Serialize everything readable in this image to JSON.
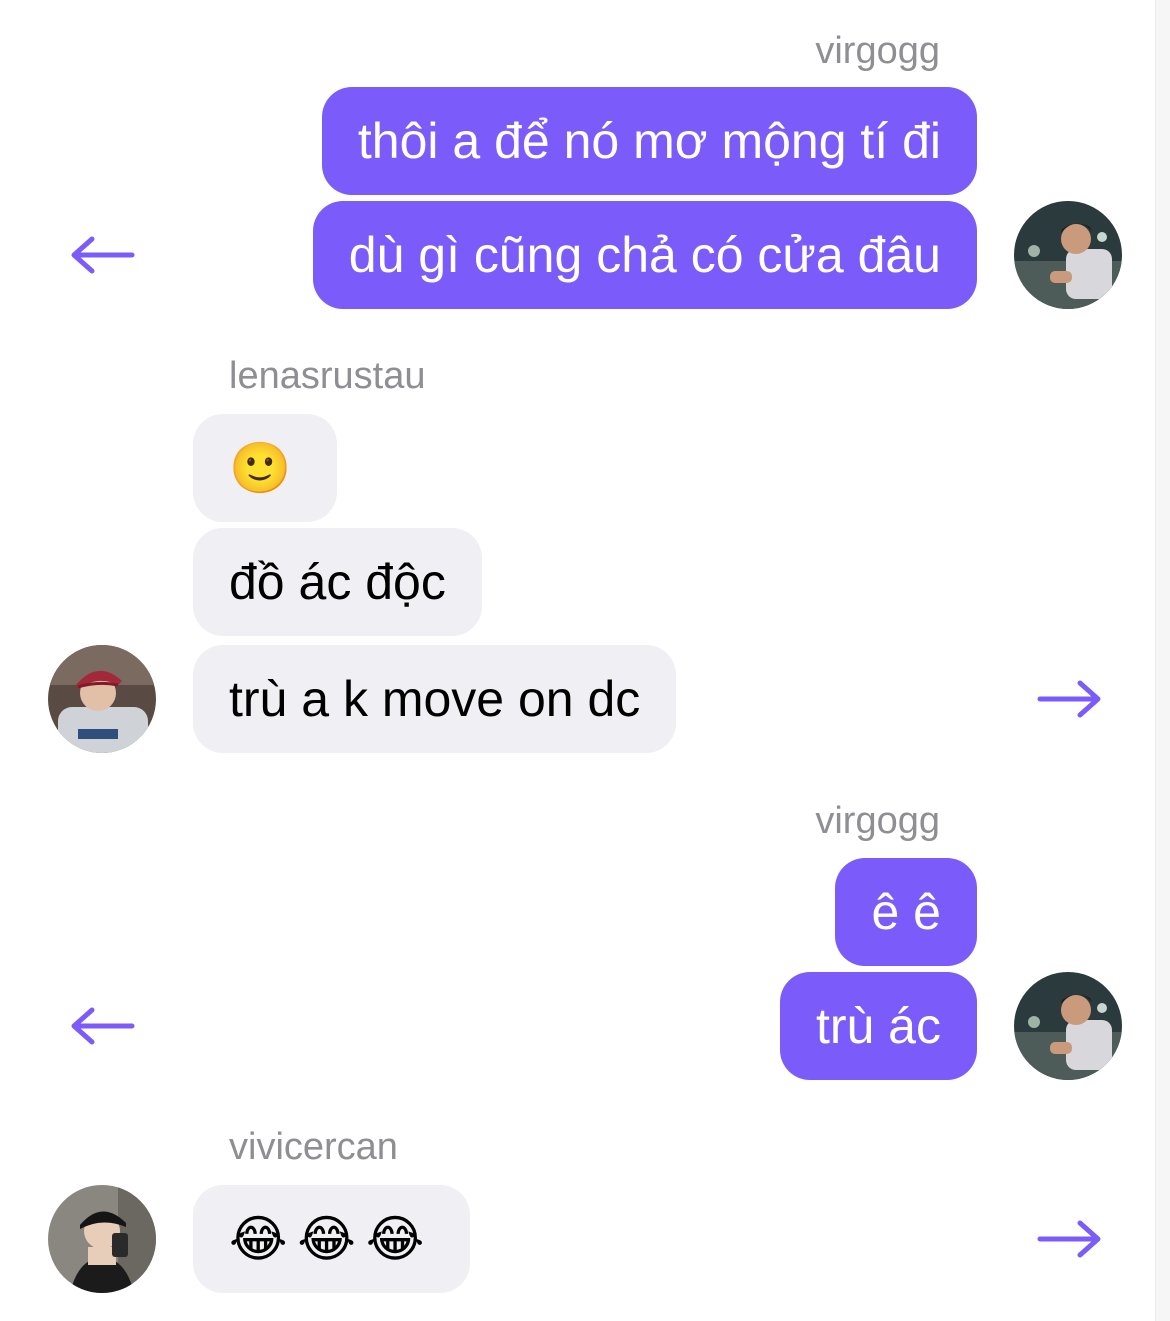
{
  "groups": [
    {
      "sender": "virgogg",
      "direction": "outgoing",
      "messages": [
        "thôi a để nó mơ mộng tí đi",
        "dù gì cũng chả có cửa đâu"
      ],
      "reply_icon": "arrow-left-icon",
      "avatar_icon": "user-avatar-icon"
    },
    {
      "sender": "lenasrustau",
      "direction": "incoming",
      "messages": [
        "🙂",
        "đồ ác độc",
        "trù a k move on dc"
      ],
      "reply_icon": "arrow-right-icon",
      "avatar_icon": "user-avatar-icon"
    },
    {
      "sender": "virgogg",
      "direction": "outgoing",
      "messages": [
        "ê ê",
        "trù ác"
      ],
      "reply_icon": "arrow-left-icon",
      "avatar_icon": "user-avatar-icon"
    },
    {
      "sender": "vivicercan",
      "direction": "incoming",
      "messages": [
        "😂😂😂"
      ],
      "reply_icon": "arrow-right-icon",
      "avatar_icon": "user-avatar-icon"
    }
  ],
  "colors": {
    "outgoing_bubble": "#7b5cfa",
    "incoming_bubble": "#efeff4",
    "sender_name": "#8e8e93",
    "arrow": "#7b5cfa"
  }
}
